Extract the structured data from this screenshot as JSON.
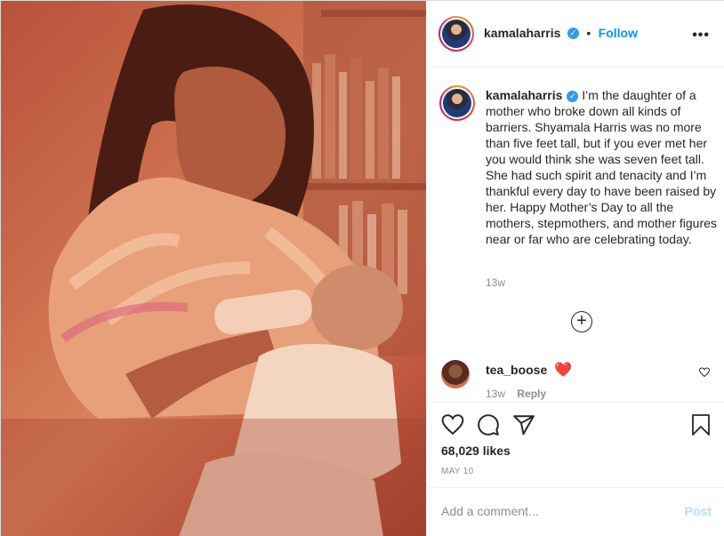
{
  "post": {
    "username": "kamalaharris",
    "verified": true,
    "follow_label": "Follow",
    "separator": "•",
    "more_label": "•••",
    "caption": "I’m the daughter of a mother who broke down all kinds of barriers. Shyamala Harris was no more than five feet tall, but if you ever met her you would think she was seven feet tall. She had such spirit and tenacity and I’m thankful every day to have been raised by her. Happy Mother’s Day to all the mothers, stepmothers, and mother figures near or far who are celebrating today.",
    "caption_age": "13w",
    "load_more_label": "+",
    "likes": "68,029 likes",
    "date": "MAY 10"
  },
  "comments": [
    {
      "username": "tea_boose",
      "text": "❤️",
      "age": "13w",
      "reply_label": "Reply"
    }
  ],
  "composer": {
    "placeholder": "Add a comment...",
    "post_label": "Post"
  },
  "icons": {
    "verified": "verified-badge-icon",
    "more": "more-options-icon",
    "like": "heart-icon",
    "comment": "comment-bubble-icon",
    "share": "paper-plane-icon",
    "save": "bookmark-icon",
    "load_more": "plus-circle-icon"
  },
  "colors": {
    "accent_blue": "#0095f6",
    "verified_blue": "#3897f0",
    "muted": "#8e8e8e",
    "post_disabled": "#b2dffc",
    "heart_red": "#e0245e"
  }
}
